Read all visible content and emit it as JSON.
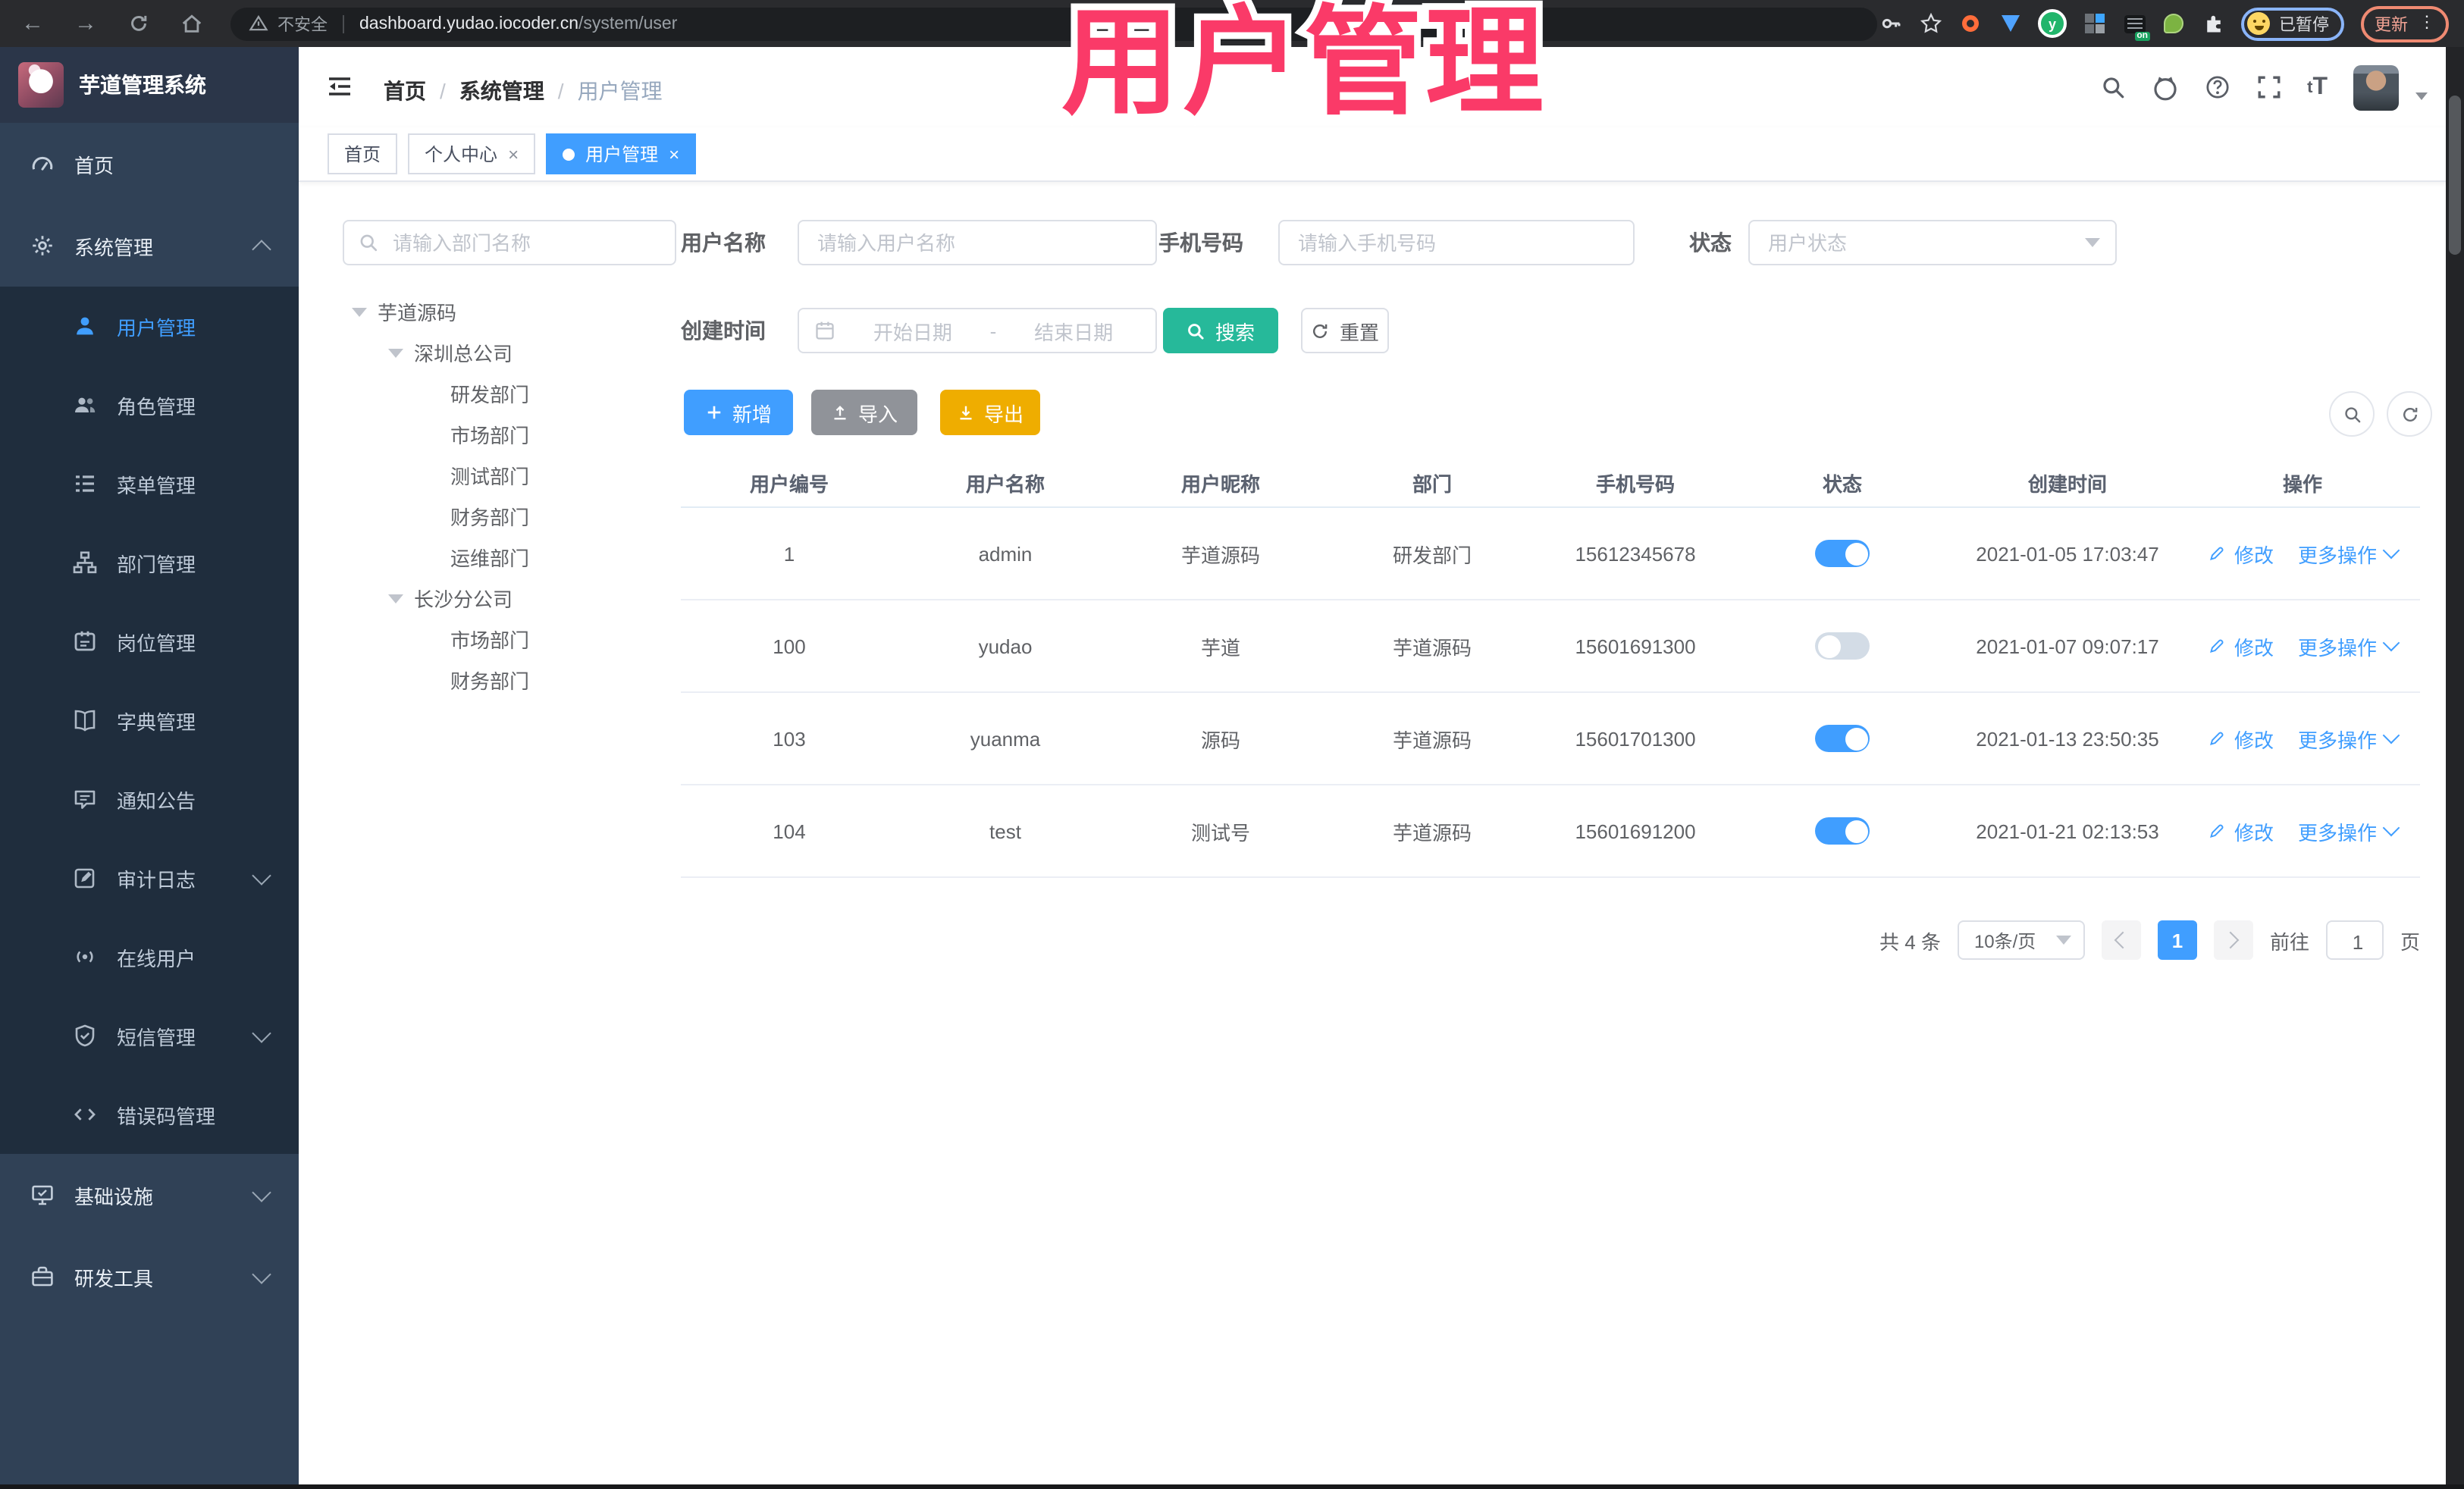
{
  "browser": {
    "security_label": "不安全",
    "url_host": "dashboard.yudao.iocoder.cn",
    "url_path": "/system/user",
    "profile_chip": "已暂停",
    "update_label": "更新"
  },
  "watermark_text": "用户管理",
  "header": {
    "logo_title": "芋道管理系统",
    "breadcrumb": {
      "home": "首页",
      "section": "系统管理",
      "current": "用户管理"
    }
  },
  "tabs": [
    {
      "label": "首页"
    },
    {
      "label": "个人中心"
    },
    {
      "label": "用户管理"
    }
  ],
  "sidebar": {
    "items": [
      {
        "label": "首页"
      },
      {
        "label": "系统管理"
      },
      {
        "label": "用户管理"
      },
      {
        "label": "角色管理"
      },
      {
        "label": "菜单管理"
      },
      {
        "label": "部门管理"
      },
      {
        "label": "岗位管理"
      },
      {
        "label": "字典管理"
      },
      {
        "label": "通知公告"
      },
      {
        "label": "审计日志"
      },
      {
        "label": "在线用户"
      },
      {
        "label": "短信管理"
      },
      {
        "label": "错误码管理"
      },
      {
        "label": "基础设施"
      },
      {
        "label": "研发工具"
      }
    ]
  },
  "dept": {
    "search_placeholder": "请输入部门名称",
    "tree": [
      "芋道源码",
      "深圳总公司",
      "研发部门",
      "市场部门",
      "测试部门",
      "财务部门",
      "运维部门",
      "长沙分公司",
      "市场部门",
      "财务部门"
    ]
  },
  "filters": {
    "username_label": "用户名称",
    "username_placeholder": "请输入用户名称",
    "mobile_label": "手机号码",
    "mobile_placeholder": "请输入手机号码",
    "status_label": "状态",
    "status_placeholder": "用户状态",
    "time_label": "创建时间",
    "date_start": "开始日期",
    "date_sep": "-",
    "date_end": "结束日期",
    "search": "搜索",
    "reset": "重置"
  },
  "toolbar": {
    "add": "新增",
    "import": "导入",
    "export": "导出"
  },
  "table": {
    "columns": [
      "用户编号",
      "用户名称",
      "用户昵称",
      "部门",
      "手机号码",
      "状态",
      "创建时间",
      "操作"
    ],
    "edit_label": "修改",
    "more_label": "更多操作",
    "rows": [
      {
        "id": "1",
        "username": "admin",
        "nickname": "芋道源码",
        "dept": "研发部门",
        "mobile": "15612345678",
        "status_on": true,
        "created": "2021-01-05 17:03:47"
      },
      {
        "id": "100",
        "username": "yudao",
        "nickname": "芋道",
        "dept": "芋道源码",
        "mobile": "15601691300",
        "status_on": false,
        "created": "2021-01-07 09:07:17"
      },
      {
        "id": "103",
        "username": "yuanma",
        "nickname": "源码",
        "dept": "芋道源码",
        "mobile": "15601701300",
        "status_on": true,
        "created": "2021-01-13 23:50:35"
      },
      {
        "id": "104",
        "username": "test",
        "nickname": "测试号",
        "dept": "芋道源码",
        "mobile": "15601691200",
        "status_on": true,
        "created": "2021-01-21 02:13:53"
      }
    ]
  },
  "pagination": {
    "total": "共 4 条",
    "page_size": "10条/页",
    "page": "1",
    "goto_label": "前往",
    "goto_value": "1",
    "unit": "页"
  },
  "colors": {
    "primary": "#409eff",
    "search_teal": "#26b99a",
    "export_yellow": "#efad00",
    "import_gray": "#909399",
    "watermark_pink": "#fa3a68",
    "sidebar_bg": "#304156",
    "submenu_bg": "#1f2d3d"
  }
}
